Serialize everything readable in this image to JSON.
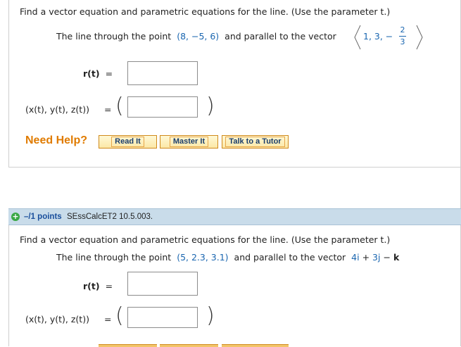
{
  "q1": {
    "instruction": "Find a vector equation and parametric equations for the line. (Use the parameter t.)",
    "line_prefix": "The line through the point",
    "point": "(8, −5, 6)",
    "line_mid": "and parallel to the vector",
    "vec_a": "1, 3, −",
    "vec_num": "2",
    "vec_den": "3",
    "r_label": "r(t)",
    "eq": "=",
    "param_label": "(x(t), y(t), z(t))"
  },
  "help": {
    "label": "Need Help?",
    "read": "Read It",
    "master": "Master It",
    "tutor": "Talk to a Tutor"
  },
  "q2": {
    "points": "–/1 points",
    "source": "SEssCalcET2 10.5.003.",
    "instruction": "Find a vector equation and parametric equations for the line. (Use the parameter t.)",
    "line_prefix": "The line through the point",
    "point": "(5, 2.3, 3.1)",
    "line_mid": "and parallel to the vector",
    "vec_i": "4i",
    "plus": "+",
    "vec_j": "3j",
    "minus": "−",
    "vec_k": "k",
    "r_label": "r(t)",
    "eq": "=",
    "param_label": "(x(t), y(t), z(t))"
  },
  "colors": {
    "accent": "#1a66b0",
    "help": "#e07b00",
    "header_bg": "#c9dcea"
  }
}
